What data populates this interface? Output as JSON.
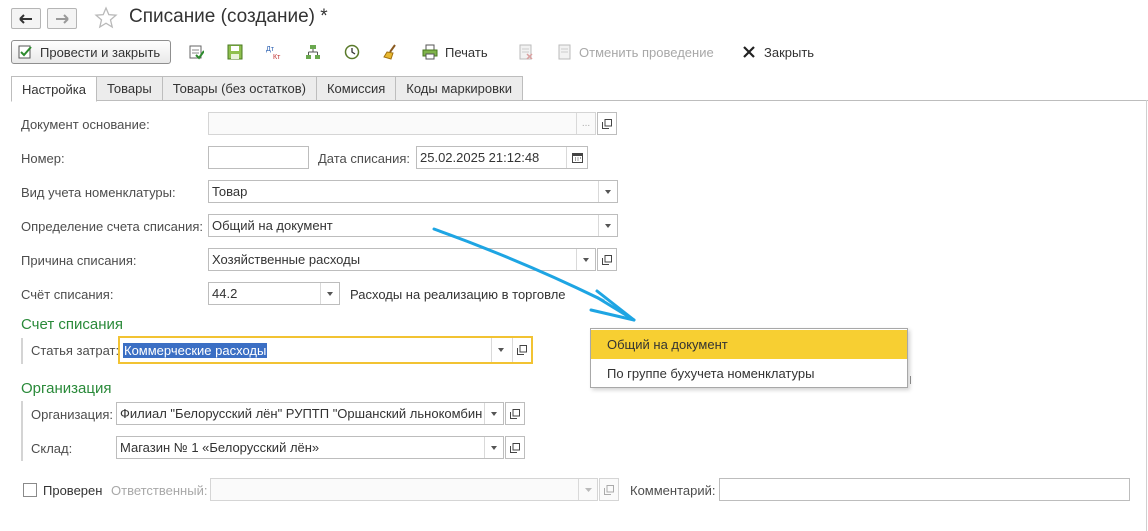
{
  "window": {
    "title": "Списание (создание) *"
  },
  "toolbar": {
    "post_close": "Провести и закрыть",
    "print": "Печать",
    "cancel_posting": "Отменить проведение",
    "close": "Закрыть",
    "dtkt_top": "Дт",
    "dtkt_bottom": "Кт"
  },
  "tabs": [
    {
      "label": "Настройка"
    },
    {
      "label": "Товары"
    },
    {
      "label": "Товары (без остатков)"
    },
    {
      "label": "Комиссия"
    },
    {
      "label": "Коды маркировки"
    }
  ],
  "form": {
    "base_doc": {
      "label": "Документ основание:",
      "value": "",
      "btn": "..."
    },
    "number": {
      "label": "Номер:",
      "value": ""
    },
    "date": {
      "label": "Дата списания:",
      "value": "25.02.2025 21:12:48"
    },
    "item_accounting": {
      "label": "Вид учета номенклатуры:",
      "value": "Товар"
    },
    "account_def": {
      "label": "Определение счета списания:",
      "value": "Общий на документ"
    },
    "reason": {
      "label": "Причина списания:",
      "value": "Хозяйственные расходы"
    },
    "account": {
      "label": "Счёт списания:",
      "value": "44.2",
      "description": "Расходы на реализацию в торговле"
    }
  },
  "section_account": {
    "title": "Счет списания",
    "cost_item": {
      "label": "Статья затрат:",
      "value": "Коммерческие расходы"
    }
  },
  "section_org": {
    "title": "Организация",
    "org": {
      "label": "Организация:",
      "value": "Филиал \"Белорусский лён\" РУПТП \"Оршанский льнокомбин"
    },
    "warehouse": {
      "label": "Склад:",
      "value": "Магазин № 1 «Белорусский лён»"
    }
  },
  "footer": {
    "checked": {
      "label": "Проверен",
      "value": false
    },
    "responsible": {
      "label": "Ответственный:",
      "value": ""
    },
    "comment": {
      "label": "Комментарий:",
      "value": ""
    }
  },
  "popup": {
    "items": [
      {
        "label": "Общий на документ",
        "selected": true
      },
      {
        "label": "По группе бухучета номенклатуры",
        "selected": false
      }
    ]
  },
  "colors": {
    "section": "#2a8a3a",
    "highlight": "#f7cf32",
    "arrow": "#1ea5e3"
  }
}
